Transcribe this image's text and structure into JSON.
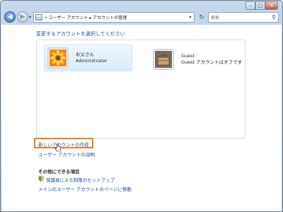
{
  "window": {
    "caption_buttons": {
      "minimize": "–",
      "maximize": "□",
      "close": "✕"
    }
  },
  "nav": {
    "back_glyph": "◀",
    "forward_glyph": "▶",
    "address_parts": "« ユーザー アカウント ▸ アカウントの管理",
    "refresh_glyph": "↻",
    "search_placeholder": "検索"
  },
  "main": {
    "heading": "変更するアカウントを選択してください",
    "accounts": [
      {
        "name": "お父さん",
        "type": "Administrator",
        "icon": "flower-photo-icon"
      },
      {
        "name": "Guest",
        "type": "Guest アカウントはオフです",
        "icon": "briefcase-icon"
      }
    ],
    "links": {
      "create_account": "新しいアカウントの作成",
      "about_accounts": "ユーザー アカウントの説明"
    },
    "other_section": {
      "title": "その他にできる項目",
      "items": [
        "保護者による制限のセットアップ",
        "メインのユーザー アカウントのページに移動"
      ]
    }
  },
  "colors": {
    "link": "#1b4f96",
    "highlight": "#f07d1f",
    "selection": "#d9ecfb"
  }
}
